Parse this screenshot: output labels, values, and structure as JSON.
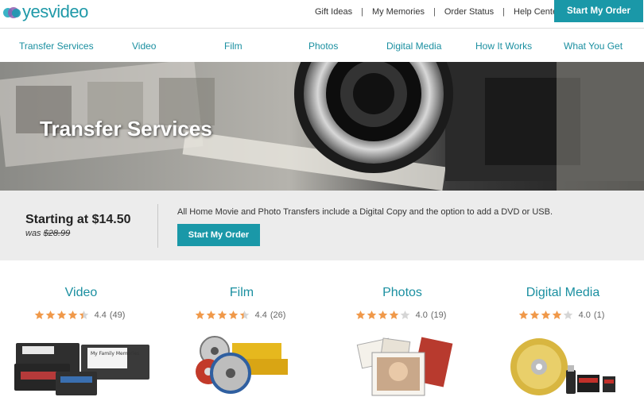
{
  "brand": {
    "name": "yesvideo"
  },
  "utility_links": [
    "Gift Ideas",
    "My Memories",
    "Order Status",
    "Help Center"
  ],
  "header_cta": "Start My Order",
  "nav": [
    "Transfer Services",
    "Video",
    "Film",
    "Photos",
    "Digital Media",
    "How It Works",
    "What You Get"
  ],
  "hero": {
    "title": "Transfer Services"
  },
  "promo": {
    "price": "Starting at $14.50",
    "was_label": "was",
    "was_price": "$28.99",
    "description": "All Home Movie and Photo Transfers include a Digital Copy and the option to add a DVD or USB.",
    "cta": "Start My Order"
  },
  "services": [
    {
      "title": "Video",
      "rating": "4.4",
      "count": "(49)",
      "stars": 4.4,
      "image_label": "My Family Memories"
    },
    {
      "title": "Film",
      "rating": "4.4",
      "count": "(26)",
      "stars": 4.4
    },
    {
      "title": "Photos",
      "rating": "4.0",
      "count": "(19)",
      "stars": 4.0
    },
    {
      "title": "Digital Media",
      "rating": "4.0",
      "count": "(1)",
      "stars": 4.0
    }
  ],
  "colors": {
    "accent": "#1a98a8",
    "star": "#f0994a",
    "star_empty": "#d6d6d6",
    "promo_bg": "#ececec"
  },
  "icons": [
    "star-icon",
    "half-star-icon",
    "logo-dots-icon"
  ]
}
